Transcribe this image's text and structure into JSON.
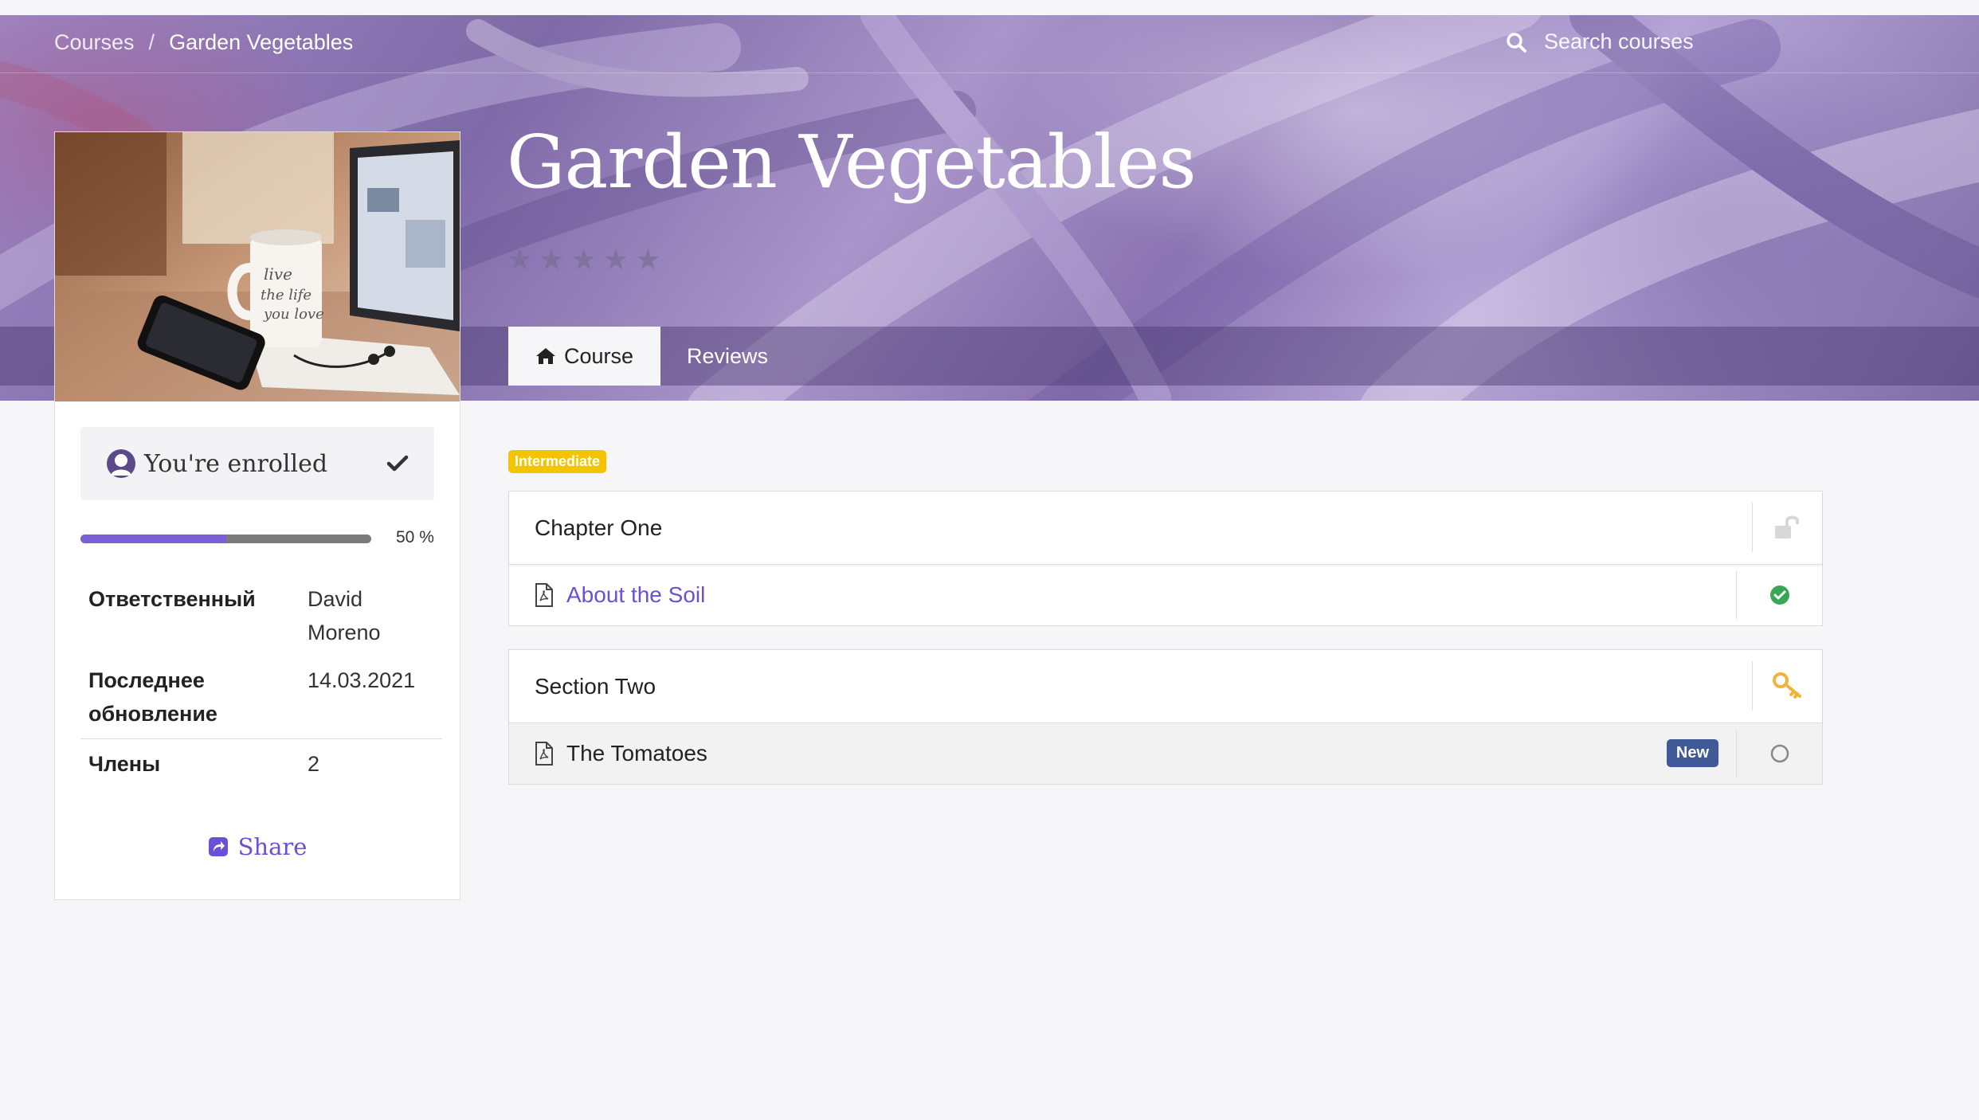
{
  "breadcrumb": {
    "parent": "Courses",
    "separator": "/",
    "current": "Garden Vegetables"
  },
  "search": {
    "placeholder": "Search courses"
  },
  "course": {
    "title": "Garden Vegetables",
    "rating_stars": 5,
    "rating_filled": 0,
    "level_badge": "Intermediate"
  },
  "tabs": [
    {
      "label": "Course",
      "icon": "home-icon",
      "active": true
    },
    {
      "label": "Reviews",
      "active": false
    }
  ],
  "sidebar": {
    "enrolled_label": "You're enrolled",
    "progress_value": 50,
    "progress_label": "50 %",
    "info": [
      {
        "key": "Ответственный",
        "value": "David Moreno"
      },
      {
        "key": "Последнее обновление",
        "value": "14.03.2021"
      },
      {
        "key": "Члены",
        "value": "2"
      }
    ],
    "share_label": "Share"
  },
  "sections": [
    {
      "title": "Chapter One",
      "icon": "unlock-icon",
      "lessons": [
        {
          "title": "About the Soil",
          "type": "pdf",
          "status": "completed",
          "is_link": true
        }
      ]
    },
    {
      "title": "Section Two",
      "icon": "key-icon",
      "lessons": [
        {
          "title": "The Tomatoes",
          "type": "pdf",
          "status": "not-started",
          "badge": "New"
        }
      ]
    }
  ],
  "colors": {
    "accent": "#6a4fd8",
    "progress": "#7b5fd6",
    "level_badge": "#f5c400",
    "new_badge": "#3f5a97",
    "completed": "#3aa655",
    "key": "#f0b43a"
  }
}
